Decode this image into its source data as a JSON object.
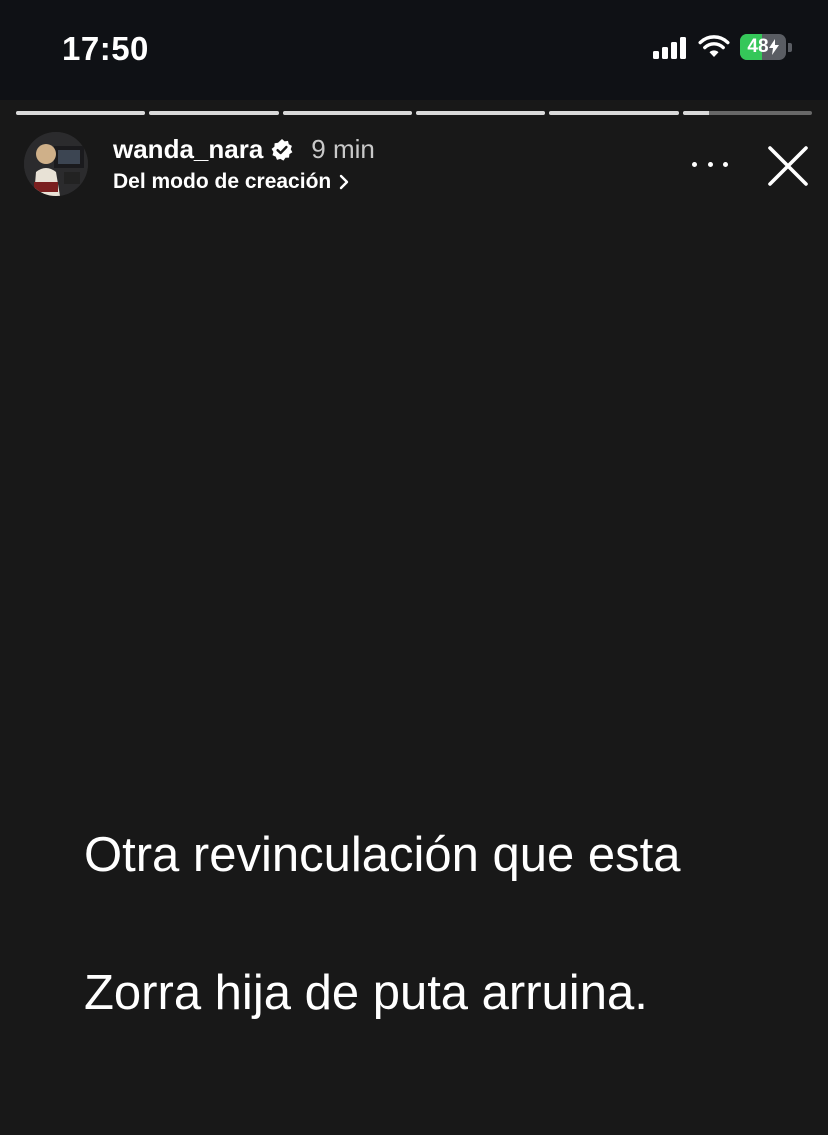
{
  "status_bar": {
    "time": "17:50",
    "battery_level": "48",
    "battery_fill_fraction": 0.48,
    "icons": [
      "signal-icon",
      "wifi-icon",
      "battery-charging-icon"
    ],
    "colors": {
      "battery_fill": "#35c759"
    }
  },
  "story": {
    "segments": [
      {
        "progress": 1
      },
      {
        "progress": 1
      },
      {
        "progress": 1
      },
      {
        "progress": 1
      },
      {
        "progress": 1
      },
      {
        "progress": 0.2
      }
    ],
    "author": {
      "username": "wanda_nara",
      "verified": true,
      "posted_ago": "9 min",
      "source_label": "Del modo de creación"
    },
    "actions": {
      "more_icon": "more-horizontal-icon",
      "close_icon": "close-icon"
    },
    "text_lines": [
      "Otra  revinculación que esta",
      "Zorra hija de puta arruina."
    ],
    "background_color": "#181818"
  }
}
